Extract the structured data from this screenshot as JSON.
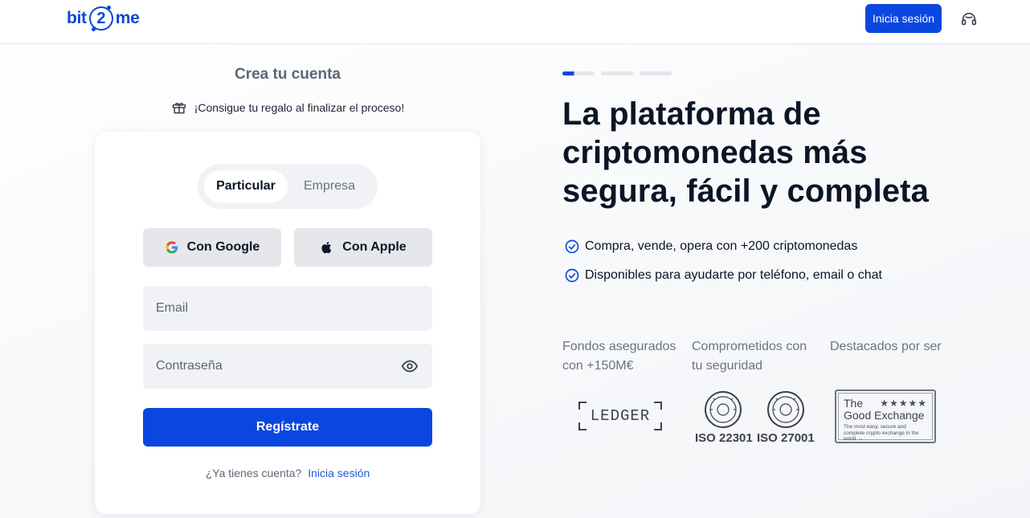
{
  "header": {
    "logo": {
      "left": "bit",
      "middle": "2",
      "right": "me"
    },
    "login_button": "Inicia sesión",
    "support_icon": "headset-icon"
  },
  "signup": {
    "title": "Crea tu cuenta",
    "gift_text": "¡Consigue tu regalo al finalizar el proceso!",
    "account_types": [
      "Particular",
      "Empresa"
    ],
    "selected_account_type": "Particular",
    "google_button": "Con Google",
    "apple_button": "Con Apple",
    "email_placeholder": "Email",
    "password_placeholder": "Contraseña",
    "register_button": "Regístrate",
    "have_account_text": "¿Ya tienes cuenta?",
    "login_link": "Inicia sesión"
  },
  "hero": {
    "slide_count": 3,
    "active_slide": 1,
    "headline": "La plataforma de criptomonedas más segura, fácil y completa",
    "features": [
      "Compra, vende, opera con +200 criptomonedas",
      "Disponibles para ayudarte por teléfono, email o chat"
    ]
  },
  "trust": {
    "labels": [
      "Fondos asegurados con +150M€",
      "Comprometidos con tu seguridad",
      "Destacados por ser"
    ],
    "ledger_logo": "LEDGER",
    "iso_badges": [
      "ISO 22301",
      "ISO 27001"
    ],
    "good_exchange": {
      "line1": "The",
      "stars": "★★★★★",
      "line2": "Good Exchange",
      "tagline": "The most easy, secure and complete crypto exchange in the world →"
    }
  },
  "colors": {
    "primary": "#0a47e0",
    "text": "#0b1526",
    "muted": "#5d6675",
    "field_bg": "#f1f2f5",
    "social_bg": "#e5e7eb"
  }
}
